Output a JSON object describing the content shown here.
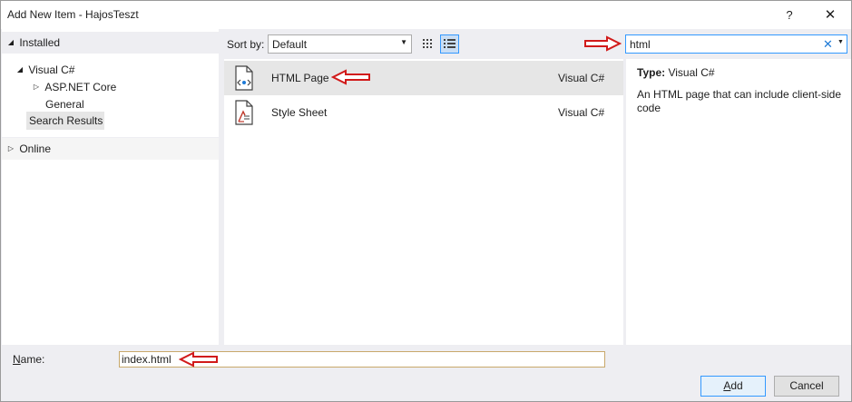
{
  "window": {
    "title": "Add New Item - HajosTeszt",
    "help_icon": "question-mark",
    "close_icon": "close-x"
  },
  "tree": {
    "installed": "Installed",
    "visual_csharp": "Visual C#",
    "aspnet_core": "ASP.NET Core",
    "general": "General",
    "search_results": "Search Results",
    "online": "Online"
  },
  "toolbar": {
    "sort_label": "Sort by:",
    "sort_value": "Default",
    "search_value": "html"
  },
  "items": [
    {
      "name": "HTML Page",
      "lang": "Visual C#",
      "icon": "html-page-icon"
    },
    {
      "name": "Style Sheet",
      "lang": "Visual C#",
      "icon": "stylesheet-icon"
    }
  ],
  "detail": {
    "type_label": "Type:",
    "type_value": "Visual C#",
    "description": "An HTML page that can include client-side code"
  },
  "footer": {
    "name_label": "Name:",
    "name_value": "index.html",
    "add_label": "Add",
    "cancel_label": "Cancel"
  },
  "colors": {
    "annotation_arrow": "#d11a1a",
    "accent": "#3399ff"
  }
}
